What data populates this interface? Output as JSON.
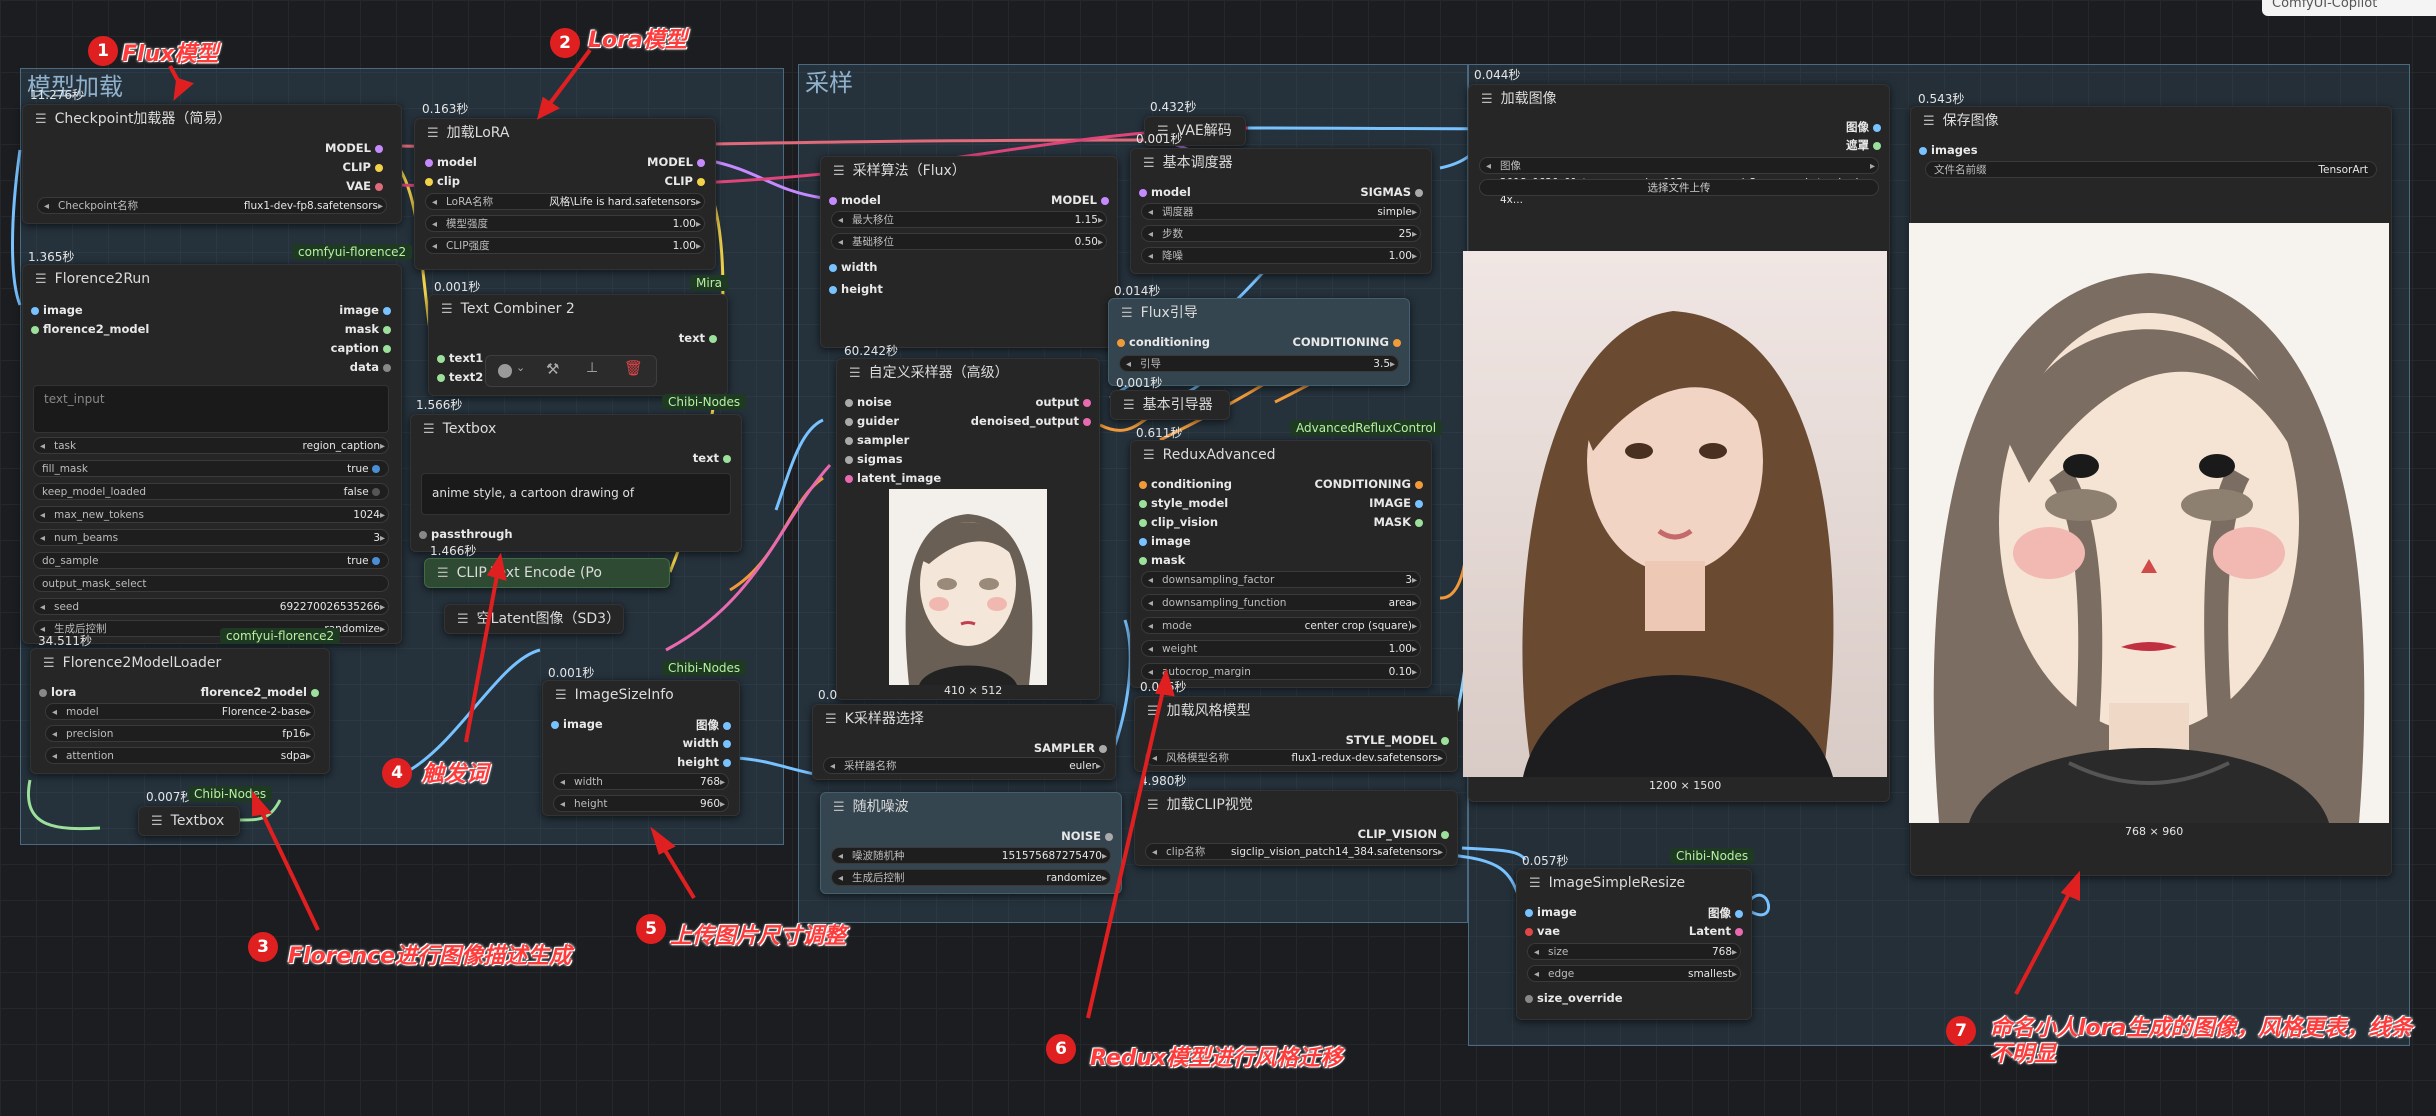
{
  "groups": {
    "g1": "模型加载",
    "g2": "采样"
  },
  "top_right": "ComfyUI-Copilot",
  "checkpoint": {
    "time": "11.276秒",
    "title": "Checkpoint加载器（简易）",
    "out_model": "MODEL",
    "out_clip": "CLIP",
    "out_vae": "VAE",
    "w_label": "Checkpoint名称",
    "w_value": "flux1-dev-fp8.safetensors"
  },
  "lora": {
    "time": "0.163秒",
    "title": "加载LoRA",
    "in_model": "model",
    "in_clip": "clip",
    "out_model": "MODEL",
    "out_clip": "CLIP",
    "w1_l": "LoRA名称",
    "w1_v": "风格\\Life is hard.safetensors",
    "w2_l": "模型强度",
    "w2_v": "1.00",
    "w3_l": "CLIP强度",
    "w3_v": "1.00",
    "tag": "Mira"
  },
  "florence_run": {
    "time": "1.365秒",
    "title": "Florence2Run",
    "tag": "comfyui-florence2",
    "in1": "image",
    "in2": "florence2_model",
    "out1": "image",
    "out2": "mask",
    "out3": "caption",
    "out4": "data",
    "text_input": "text_input",
    "w": [
      [
        "task",
        "region_caption"
      ],
      [
        "fill_mask",
        "true"
      ],
      [
        "keep_model_loaded",
        "false"
      ],
      [
        "max_new_tokens",
        "1024"
      ],
      [
        "num_beams",
        "3"
      ],
      [
        "do_sample",
        "true"
      ],
      [
        "output_mask_select",
        ""
      ],
      [
        "seed",
        "692270026535266"
      ],
      [
        "生成后控制",
        "randomize"
      ]
    ]
  },
  "florence_loader": {
    "time": "34.511秒",
    "title": "Florence2ModelLoader",
    "tag": "comfyui-florence2",
    "in1": "lora",
    "out1": "florence2_model",
    "w": [
      [
        "model",
        "Florence-2-base"
      ],
      [
        "precision",
        "fp16"
      ],
      [
        "attention",
        "sdpa"
      ]
    ]
  },
  "textcomb": {
    "time": "0.001秒",
    "title": "Text Combiner 2",
    "in1": "text1",
    "in2": "text2",
    "out1": "text",
    "tag": "Chibi-Nodes"
  },
  "textbox": {
    "time": "1.566秒",
    "title": "Textbox",
    "out": "text",
    "content": "anime style,  a cartoon drawing of",
    "in": "passthrough"
  },
  "clipenc": {
    "title": "CLIP Text Encode (Po",
    "time": "1.466秒"
  },
  "latent": {
    "title": "空Latent图像（SD3）"
  },
  "textbox2": {
    "time": "0.007秒",
    "tag": "Chibi-Nodes",
    "title": "Textbox"
  },
  "imgsize": {
    "time": "0.001秒",
    "tag": "Chibi-Nodes",
    "title": "ImageSizeInfo",
    "in": "image",
    "out1": "图像",
    "out2": "width",
    "out3": "height",
    "w1_l": "width",
    "w1_v": "768",
    "w2_l": "height",
    "w2_v": "960"
  },
  "sampler_algo": {
    "title": "采样算法（Flux）",
    "in1": "model",
    "out1": "MODEL",
    "w1_l": "最大移位",
    "w1_v": "1.15",
    "w2_l": "基础移位",
    "w2_v": "0.50",
    "in2": "width",
    "in3": "height"
  },
  "custom_sampler": {
    "time": "60.242秒",
    "title": "自定义采样器（高级）",
    "in": [
      "noise",
      "guider",
      "sampler",
      "sigmas",
      "latent_image"
    ],
    "out1": "output",
    "out2": "denoised_output",
    "size": "410 × 512"
  },
  "ksampler_sel": {
    "title": "K采样器选择",
    "out": "SAMPLER",
    "w_l": "采样器名称",
    "w_v": "euler",
    "time": "0.0"
  },
  "noise": {
    "title": "随机噪波",
    "out": "NOISE",
    "w1_l": "噪波随机种",
    "w1_v": "151575687275470",
    "w2_l": "生成后控制",
    "w2_v": "randomize"
  },
  "vae_decode": {
    "time": "0.432秒",
    "title": "VAE解码"
  },
  "scheduler": {
    "time": "0.001秒",
    "title": "基本调度器",
    "in": "model",
    "out": "SIGMAS",
    "w": [
      [
        "调度器",
        "simple"
      ],
      [
        "步数",
        "25"
      ],
      [
        "降噪",
        "1.00"
      ]
    ]
  },
  "flux_guide": {
    "time": "0.014秒",
    "title": "Flux引导",
    "in": "conditioning",
    "out": "CONDITIONING",
    "w_l": "引导",
    "w_v": "3.5"
  },
  "basic_guider": {
    "time": "0.001秒",
    "title": "基本引导器"
  },
  "redux": {
    "time": "0.611秒",
    "tag": "AdvancedRefluxControl",
    "title": "ReduxAdvanced",
    "in": [
      "conditioning",
      "style_model",
      "clip_vision",
      "image",
      "mask"
    ],
    "out": [
      "CONDITIONING",
      "IMAGE",
      "MASK"
    ],
    "w": [
      [
        "downsampling_factor",
        "3"
      ],
      [
        "downsampling_function",
        "area"
      ],
      [
        "mode",
        "center crop (square)"
      ],
      [
        "weight",
        "1.00"
      ],
      [
        "autocrop_margin",
        "0.10"
      ]
    ]
  },
  "style_model": {
    "time": "0.086秒",
    "title": "加载风格模型",
    "out": "STYLE_MODEL",
    "w_l": "风格模型名称",
    "w_v": "flux1-redux-dev.safetensors"
  },
  "clip_vision": {
    "time": "4.980秒",
    "title": "加载CLIP视觉",
    "out": "CLIP_VISION",
    "w_l": "clip名称",
    "w_v": "sigclip_vision_patch14_384.safetensors"
  },
  "load_image": {
    "time": "0.044秒",
    "title": "加载图像",
    "out1": "图像",
    "out2": "遮罩",
    "w_l": "图像",
    "w_v": "2018_0620_01_tomarusayaka_005-pc_upscayl_2x_upscayl-standard-4x...",
    "upload": "选择文件上传",
    "size": "1200 × 1500"
  },
  "save_image": {
    "time": "0.543秒",
    "title": "保存图像",
    "in": "images",
    "w_l": "文件名前缀",
    "w_v": "TensorArt",
    "size": "768 × 960"
  },
  "resize": {
    "time": "0.057秒",
    "tag": "Chibi-Nodes",
    "title": "ImageSimpleResize",
    "in1": "image",
    "in2": "vae",
    "out1": "图像",
    "out2": "Latent",
    "w1_l": "size",
    "w1_v": "768",
    "w2_l": "edge",
    "w2_v": "smallest",
    "in3": "size_override"
  },
  "annotations": [
    {
      "n": "1",
      "t": "Flux模型"
    },
    {
      "n": "2",
      "t": "Lora模型"
    },
    {
      "n": "3",
      "t": "Florence进行图像描述生成"
    },
    {
      "n": "4",
      "t": "触发词"
    },
    {
      "n": "5",
      "t": "上传图片尺寸调整"
    },
    {
      "n": "6",
      "t": "Redux模型进行风格迁移"
    },
    {
      "n": "7",
      "t": "命名小人lora生成的图像，风格更表，线条不明显"
    }
  ]
}
